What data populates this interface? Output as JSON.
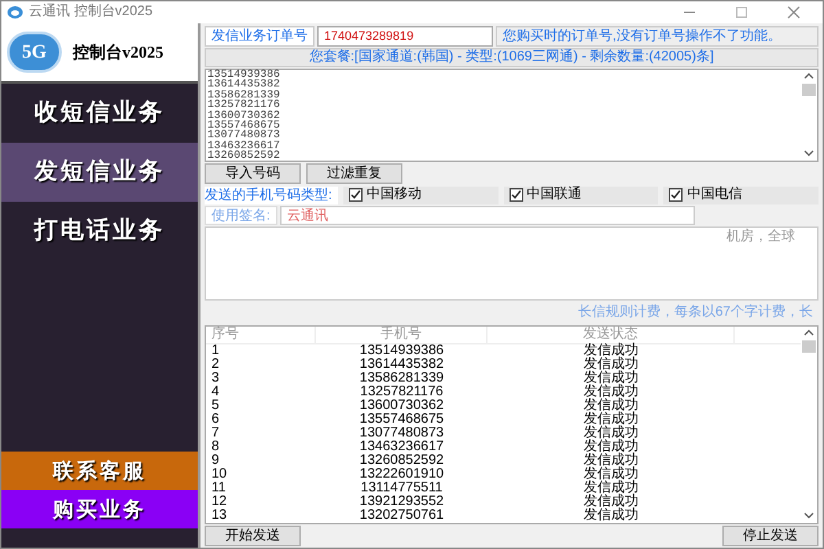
{
  "window": {
    "title": "云通讯 控制台v2025"
  },
  "sidebar": {
    "logo_badge": "5G",
    "logo_title": "控制台v2025",
    "menu": [
      {
        "label": "收短信业务",
        "selected": false
      },
      {
        "label": "发短信业务",
        "selected": true
      },
      {
        "label": "打电话业务",
        "selected": false
      }
    ],
    "actions": [
      {
        "label": "联系客服",
        "color": "#c8680c"
      },
      {
        "label": "购买业务",
        "color": "#8a00f5"
      }
    ]
  },
  "order": {
    "label": "发信业务订单号",
    "value": "1740473289819",
    "note": "您购买时的订单号,没有订单号操作不了功能。"
  },
  "package_info": "您套餐:[国家通道:(韩国) - 类型:(1069三网通) - 剩余数量:(42005)条]",
  "numbers": [
    "13514939386",
    "13614435382",
    "13586281339",
    "13257821176",
    "13600730362",
    "13557468675",
    "13077480873",
    "13463236617",
    "13260852592"
  ],
  "number_buttons": [
    "导入号码",
    "过滤重复"
  ],
  "carrier_filter": {
    "label": "发送的手机号码类型:",
    "options": [
      {
        "label": "中国移动",
        "checked": true
      },
      {
        "label": "中国联通",
        "checked": true
      },
      {
        "label": "中国电信",
        "checked": true
      }
    ]
  },
  "signature": {
    "label": "使用签名:",
    "value": "云通讯"
  },
  "message_fragment": "机房，全球",
  "hint_fragment": "长信规则计费，每条以67个字计费，长",
  "table": {
    "columns": [
      "序号",
      "手机号",
      "发送状态"
    ],
    "rows": [
      [
        "1",
        "13514939386",
        "发信成功"
      ],
      [
        "2",
        "13614435382",
        "发信成功"
      ],
      [
        "3",
        "13586281339",
        "发信成功"
      ],
      [
        "4",
        "13257821176",
        "发信成功"
      ],
      [
        "5",
        "13600730362",
        "发信成功"
      ],
      [
        "6",
        "13557468675",
        "发信成功"
      ],
      [
        "7",
        "13077480873",
        "发信成功"
      ],
      [
        "8",
        "13463236617",
        "发信成功"
      ],
      [
        "9",
        "13260852592",
        "发信成功"
      ],
      [
        "10",
        "13222601910",
        "发信成功"
      ],
      [
        "11",
        "13114775511",
        "发信成功"
      ],
      [
        "12",
        "13921293552",
        "发信成功"
      ],
      [
        "13",
        "13202750761",
        "发信成功"
      ]
    ]
  },
  "bottom_buttons": [
    "开始发送",
    "停止发送"
  ]
}
